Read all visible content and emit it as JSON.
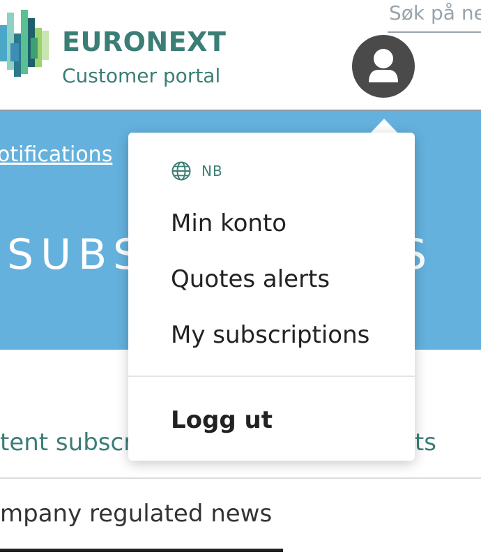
{
  "header": {
    "brand": "EURONEXT",
    "subtitle": "Customer portal",
    "search_placeholder": "Søk på nettsted"
  },
  "banner": {
    "notifications_link": "otifications",
    "title": "SUBSCRIPTIONS"
  },
  "tabs": {
    "left": "tent subscriptions",
    "right": "erts"
  },
  "news_tab": "mpany regulated news",
  "dropdown": {
    "language": "NB",
    "items": [
      "Min konto",
      "Quotes alerts",
      "My subscriptions"
    ],
    "logout": "Logg ut"
  },
  "colors": {
    "brand_teal": "#3a7e76",
    "banner_blue": "#64b1de",
    "avatar_bg": "#4a4a4a"
  },
  "icons": {
    "language": "globe-icon",
    "user": "user-icon"
  }
}
